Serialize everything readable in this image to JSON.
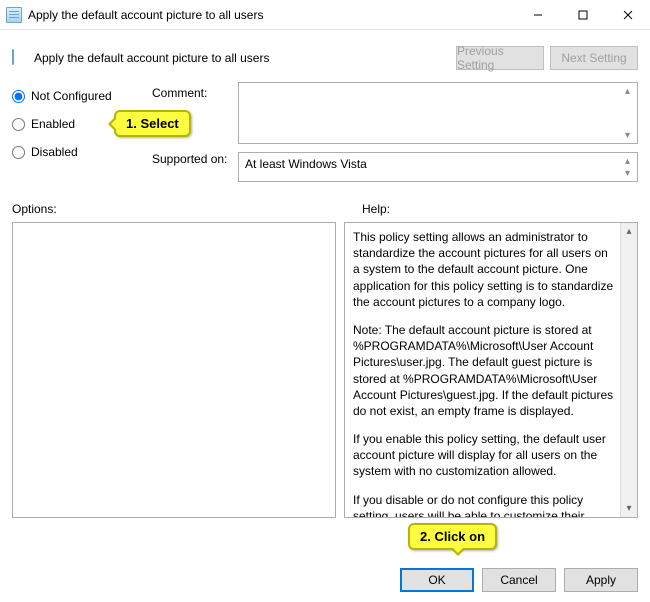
{
  "window": {
    "title": "Apply the default account picture to all users"
  },
  "header": {
    "title": "Apply the default account picture to all users",
    "prev": "Previous Setting",
    "next": "Next Setting"
  },
  "radios": {
    "notconf": "Not Configured",
    "enabled": "Enabled",
    "disabled": "Disabled"
  },
  "labels": {
    "comment": "Comment:",
    "supported": "Supported on:",
    "options": "Options:",
    "help": "Help:"
  },
  "supported_text": "At least Windows Vista",
  "help": {
    "p1": "This policy setting allows an administrator to standardize the account pictures for all users on a system to the default account picture. One application for this policy setting is to standardize the account pictures to a company logo.",
    "p2": "Note: The default account picture is stored at %PROGRAMDATA%\\Microsoft\\User Account Pictures\\user.jpg. The default guest picture is stored at %PROGRAMDATA%\\Microsoft\\User Account Pictures\\guest.jpg. If the default pictures do not exist, an empty frame is displayed.",
    "p3": "If you enable this policy setting, the default user account picture will display for all users on the system with no customization allowed.",
    "p4": "If you disable or do not configure this policy setting, users will be able to customize their account pictures."
  },
  "buttons": {
    "ok": "OK",
    "cancel": "Cancel",
    "apply": "Apply"
  },
  "callouts": {
    "select": "1.  Select",
    "clickon": "2.  Click on"
  }
}
